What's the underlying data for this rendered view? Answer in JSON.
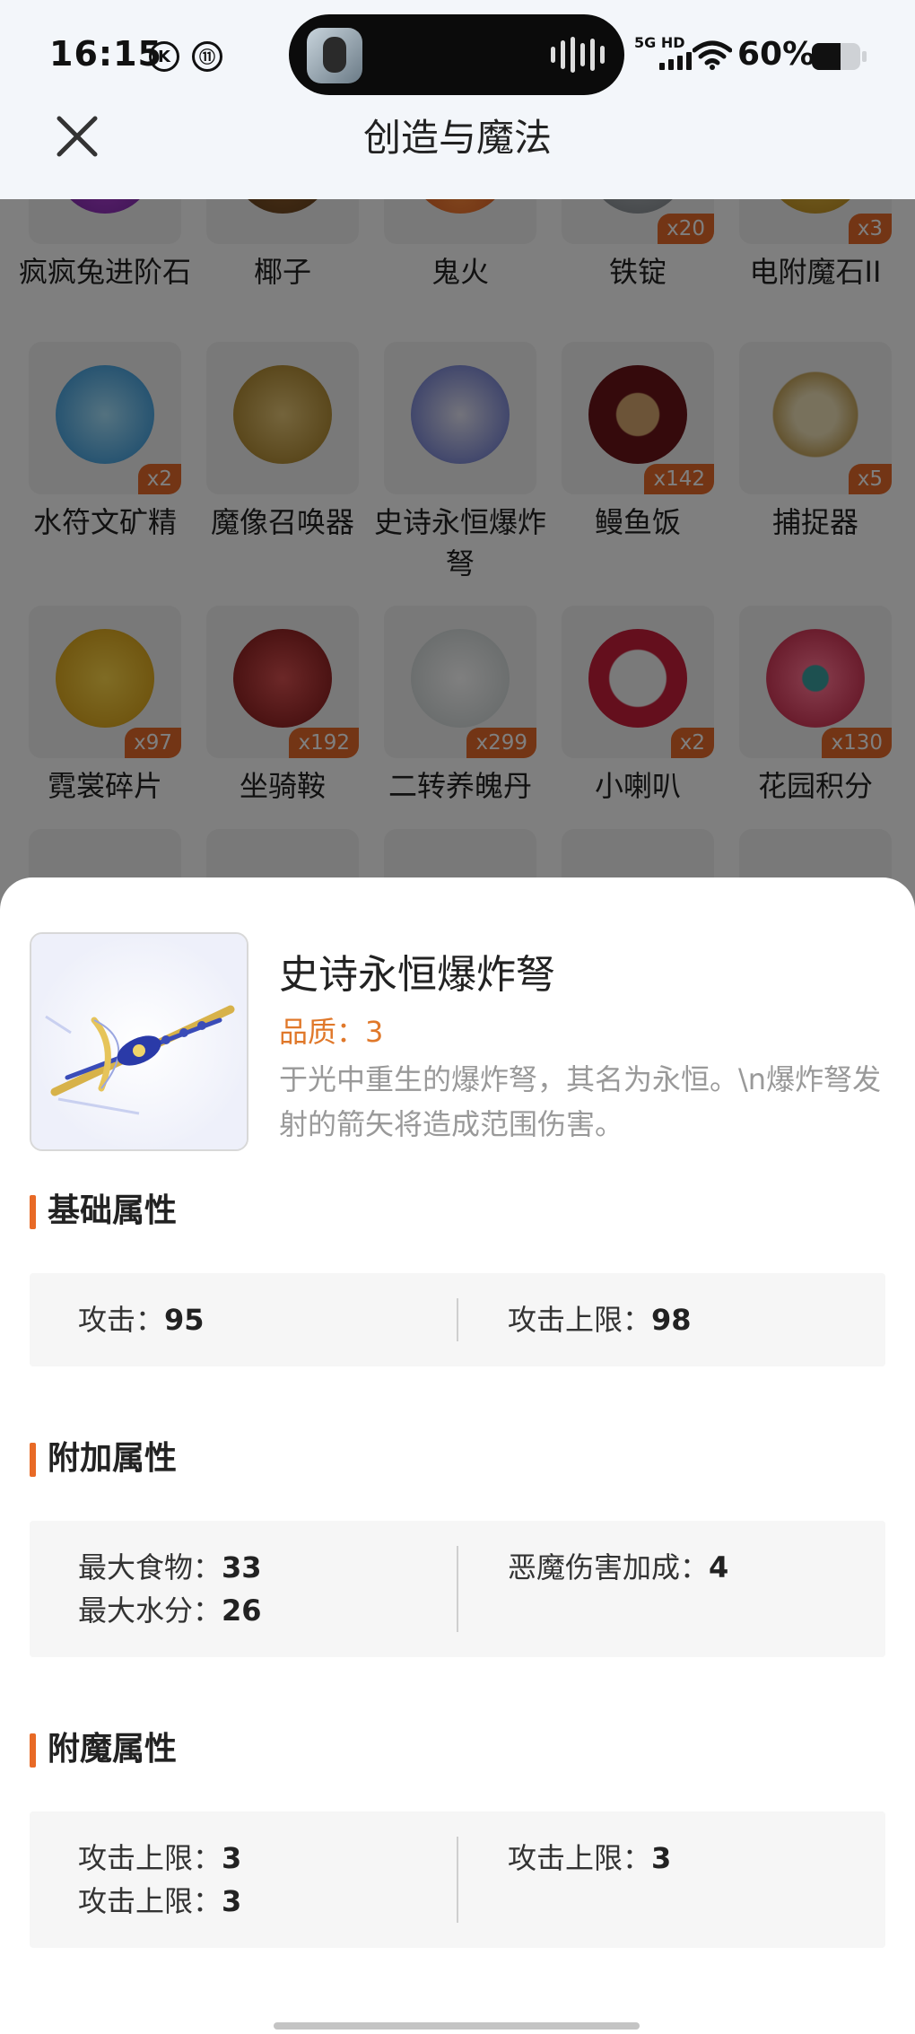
{
  "status_bar": {
    "time": "16:15",
    "indicator_1": "K",
    "indicator_2": "⑪",
    "network": "5G HD",
    "battery_percent": "60%",
    "battery_level": 0.6
  },
  "header": {
    "title": "创造与魔法"
  },
  "grid": {
    "rows": [
      [
        {
          "name": "疯疯兔进阶石",
          "count": "",
          "icon": "gem-icon"
        },
        {
          "name": "椰子",
          "count": "",
          "icon": "coconut-icon"
        },
        {
          "name": "鬼火",
          "count": "",
          "icon": "fire-icon"
        },
        {
          "name": "铁锭",
          "count": "x20",
          "icon": "ingot-icon"
        },
        {
          "name": "电附魔石II",
          "count": "x3",
          "icon": "stone-icon"
        }
      ],
      [
        {
          "name": "水符文矿精",
          "count": "x2",
          "icon": "crystal-icon"
        },
        {
          "name": "魔像召唤器",
          "count": "",
          "icon": "summoner-icon"
        },
        {
          "name": "史诗永恒爆炸弩",
          "count": "",
          "icon": "crossbow-icon"
        },
        {
          "name": "鳗鱼饭",
          "count": "x142",
          "icon": "rice-bowl-icon"
        },
        {
          "name": "捕捉器",
          "count": "x5",
          "icon": "trap-icon"
        }
      ],
      [
        {
          "name": "霓裳碎片",
          "count": "x97",
          "icon": "shirt-icon"
        },
        {
          "name": "坐骑鞍",
          "count": "x192",
          "icon": "saddle-icon"
        },
        {
          "name": "二转养魄丹",
          "count": "x299",
          "icon": "bottle-icon"
        },
        {
          "name": "小喇叭",
          "count": "x2",
          "icon": "megaphone-icon"
        },
        {
          "name": "花园积分",
          "count": "x130",
          "icon": "flower-icon"
        }
      ]
    ]
  },
  "detail": {
    "name": "史诗永恒爆炸弩",
    "quality_label": "品质：",
    "quality_value": "3",
    "description": "于光中重生的爆炸弩，其名为永恒。\\n爆炸弩发射的箭矢将造成范围伤害。",
    "sections": {
      "base": {
        "title": "基础属性",
        "left": [
          {
            "label": "攻击：",
            "value": "95"
          }
        ],
        "right": [
          {
            "label": "攻击上限：",
            "value": "98"
          }
        ]
      },
      "extra": {
        "title": "附加属性",
        "left": [
          {
            "label": "最大食物：",
            "value": "33"
          },
          {
            "label": "最大水分：",
            "value": "26"
          }
        ],
        "right": [
          {
            "label": "恶魔伤害加成：",
            "value": "4"
          }
        ]
      },
      "enchant": {
        "title": "附魔属性",
        "left": [
          {
            "label": "攻击上限：",
            "value": "3"
          },
          {
            "label": "攻击上限：",
            "value": "3"
          }
        ],
        "right": [
          {
            "label": "攻击上限：",
            "value": "3"
          }
        ]
      }
    }
  },
  "colors": {
    "accent": "#e86a26",
    "quality": "#e0782a",
    "badge": "#e66a2a"
  }
}
